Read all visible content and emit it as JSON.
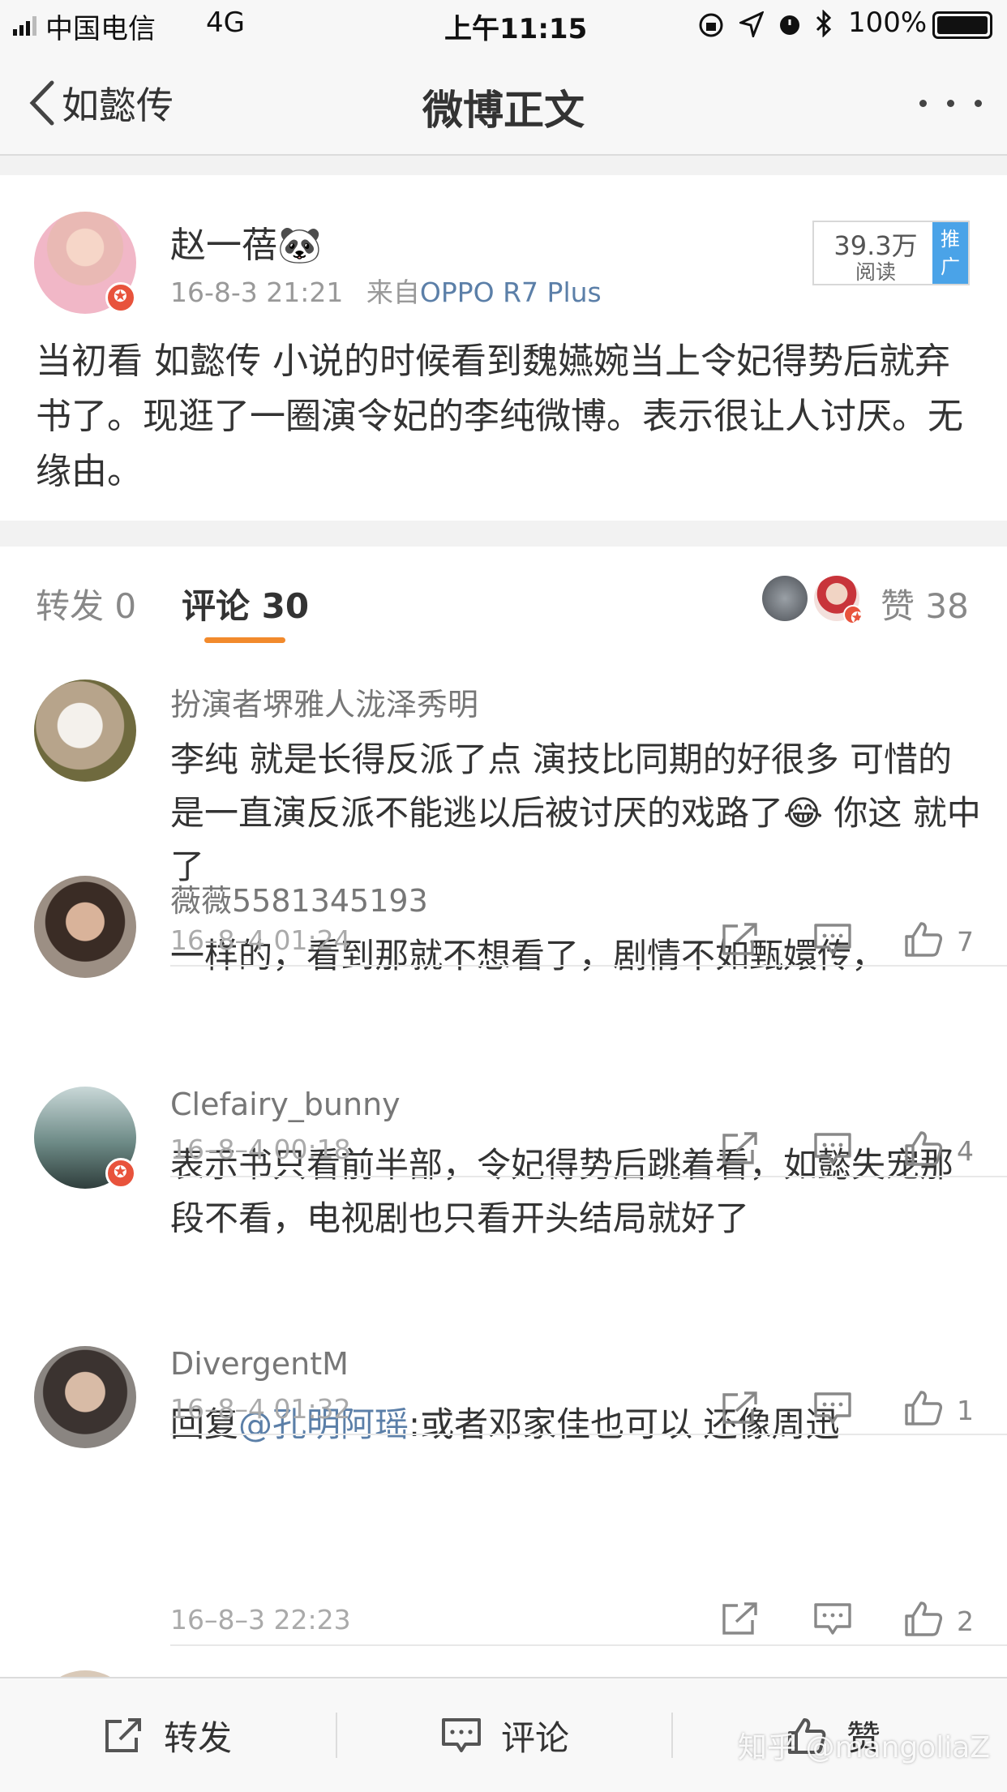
{
  "status_bar": {
    "carrier": "中国电信",
    "network": "4G",
    "time": "上午11:15",
    "battery": "100%"
  },
  "nav": {
    "back_label": "如懿传",
    "title": "微博正文"
  },
  "post": {
    "author": "赵一蓓🐼",
    "time": "16-8-3 21:21",
    "source_prefix": "来自",
    "source": "OPPO R7 Plus",
    "reads": "39.3万",
    "reads_label": "阅读",
    "promo_label": "推广",
    "text": "当初看 如懿传 小说的时候看到魏嬿婉当上令妃得势后就弃书了。现逛了一圈演令妃的李纯微博。表示很让人讨厌。无缘由。"
  },
  "tabs": {
    "repost": "转发 0",
    "comment": "评论 30",
    "like": "赞 38"
  },
  "comments": [
    {
      "name": "扮演者堺雅人泷泽秀明",
      "text": "李纯 就是长得反派了点 演技比同期的好很多 可惜的是一直演反派不能逃以后被讨厌的戏路了😂 你这 就中了",
      "time": "16–8–4 01:24",
      "likes": "7"
    },
    {
      "name": "薇薇5581345193",
      "text": "一样的，看到那就不想看了，剧情不如甄嬛传，",
      "time": "16–8–4 00:18",
      "likes": "4"
    },
    {
      "name": "Clefairy_bunny",
      "text": "表示书只看前半部，令妃得势后跳着看，如懿失宠那段不看，电视剧也只看开头结局就好了",
      "time": "16–8–4 01:32",
      "likes": "1"
    },
    {
      "name": "DivergentM",
      "reply_prefix": "回复",
      "mention": "@孔明阿瑶",
      "text": ":或者邓家佳也可以   还像周迅",
      "time": "16–8–3 22:23",
      "likes": "2"
    }
  ],
  "bottom_bar": {
    "repost": "转发",
    "comment": "评论",
    "like": "赞"
  },
  "watermark": "知乎 @mangoliaZ",
  "colors": {
    "accent_orange": "#f28a2c",
    "link_blue": "#5b7fa8",
    "verified_red": "#e8533c",
    "promo_blue": "#4aa3e8"
  }
}
